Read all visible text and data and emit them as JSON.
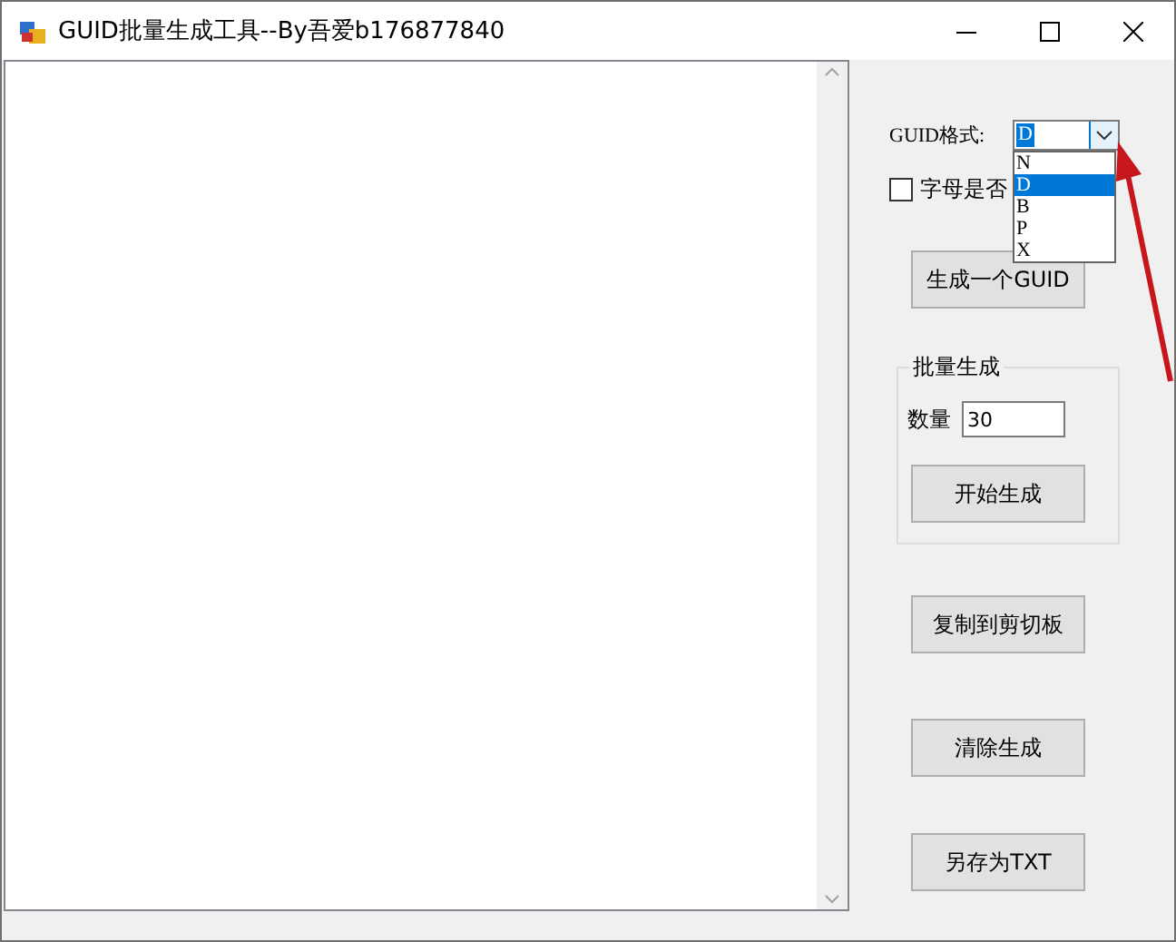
{
  "window": {
    "title": "GUID批量生成工具--By吾爱b176877840"
  },
  "format": {
    "label": "GUID格式:",
    "value": "D",
    "expanded": true,
    "options": [
      {
        "label": "N",
        "selected": false
      },
      {
        "label": "D",
        "selected": true
      },
      {
        "label": "B",
        "selected": false
      },
      {
        "label": "P",
        "selected": false
      },
      {
        "label": "X",
        "selected": false
      }
    ]
  },
  "uppercase": {
    "label": "字母是否",
    "checked": false
  },
  "generate_one": "生成一个GUID",
  "batch": {
    "title": "批量生成",
    "count_label": "数量",
    "count": "30",
    "start": "开始生成"
  },
  "buttons": [
    "复制到剪切板",
    "清除生成",
    "另存为TXT"
  ]
}
